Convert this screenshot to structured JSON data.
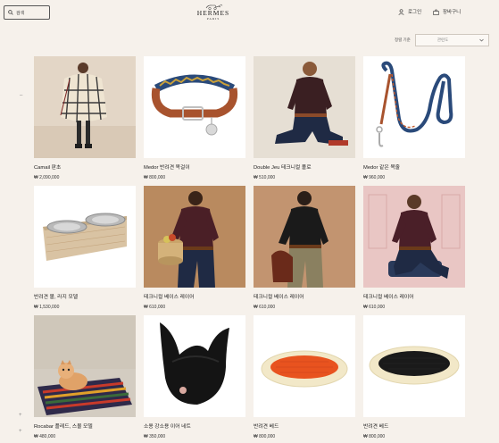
{
  "header": {
    "search_placeholder": "검색",
    "logo_name": "HERMES",
    "logo_city": "PARIS",
    "login": "로그인",
    "cart": "장바구니"
  },
  "sort": {
    "label": "정렬 기준",
    "value": "관련도"
  },
  "side_controls": {
    "top": "–",
    "bottom1": "+",
    "bottom2": "+"
  },
  "products": [
    {
      "title": "Camail 판초",
      "price": "₩ 2,090,000",
      "icon": "poncho-image"
    },
    {
      "title": "Medor 반려견 목걸이",
      "price": "₩ 800,000",
      "icon": "dog-collar-image"
    },
    {
      "title": "Double Jeu 테크니컬 폴로",
      "price": "₩ 510,000",
      "icon": "polo-image"
    },
    {
      "title": "Medor 같은 목줄",
      "price": "₩ 960,000",
      "icon": "dog-leash-image"
    },
    {
      "title": "반려견 볼, 라지 모델",
      "price": "₩ 1,530,000",
      "icon": "dog-bowl-image"
    },
    {
      "title": "테크니컬 베이스 레이어",
      "price": "₩ 610,000",
      "icon": "base-layer-image"
    },
    {
      "title": "테크니컬 베이스 레이어",
      "price": "₩ 610,000",
      "icon": "base-layer-image"
    },
    {
      "title": "테크니컬 베이스 레이어",
      "price": "₩ 610,000",
      "icon": "base-layer-image"
    },
    {
      "title": "Rocabar 플레드, 스몰 모델",
      "price": "₩ 480,000",
      "icon": "blanket-image"
    },
    {
      "title": "소용 강소용 이어 네트",
      "price": "₩ 350,000",
      "icon": "ear-net-image"
    },
    {
      "title": "반려견 베드",
      "price": "₩ 800,000",
      "icon": "dog-bed-image"
    },
    {
      "title": "반려견 베드",
      "price": "₩ 800,000",
      "icon": "dog-bed-image"
    }
  ]
}
